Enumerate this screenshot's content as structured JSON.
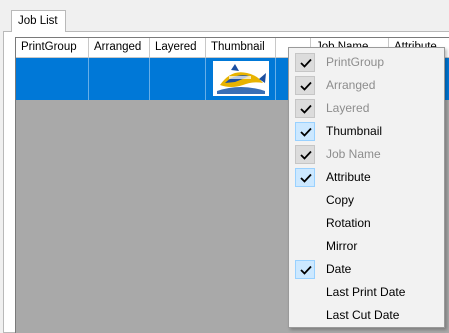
{
  "tab": {
    "label": "Job List"
  },
  "grid": {
    "columns": [
      "PrintGroup",
      "Arranged",
      "Layered",
      "Thumbnail",
      "",
      "Job Name",
      "Attribute"
    ]
  },
  "menu": {
    "items": [
      {
        "label": "PrintGroup",
        "checked": true,
        "enabled": false
      },
      {
        "label": "Arranged",
        "checked": true,
        "enabled": false
      },
      {
        "label": "Layered",
        "checked": true,
        "enabled": false
      },
      {
        "label": "Thumbnail",
        "checked": true,
        "enabled": true
      },
      {
        "label": "Job Name",
        "checked": true,
        "enabled": false
      },
      {
        "label": "Attribute",
        "checked": true,
        "enabled": true
      },
      {
        "label": "Copy",
        "checked": false,
        "enabled": true
      },
      {
        "label": "Rotation",
        "checked": false,
        "enabled": true
      },
      {
        "label": "Mirror",
        "checked": false,
        "enabled": true
      },
      {
        "label": "Date",
        "checked": true,
        "enabled": true
      },
      {
        "label": "Last Print Date",
        "checked": false,
        "enabled": true
      },
      {
        "label": "Last Cut Date",
        "checked": false,
        "enabled": true
      }
    ]
  },
  "colors": {
    "selection": "#0078d7",
    "grid_background": "#a9a9a9",
    "check_highlight": "#cce8ff"
  }
}
